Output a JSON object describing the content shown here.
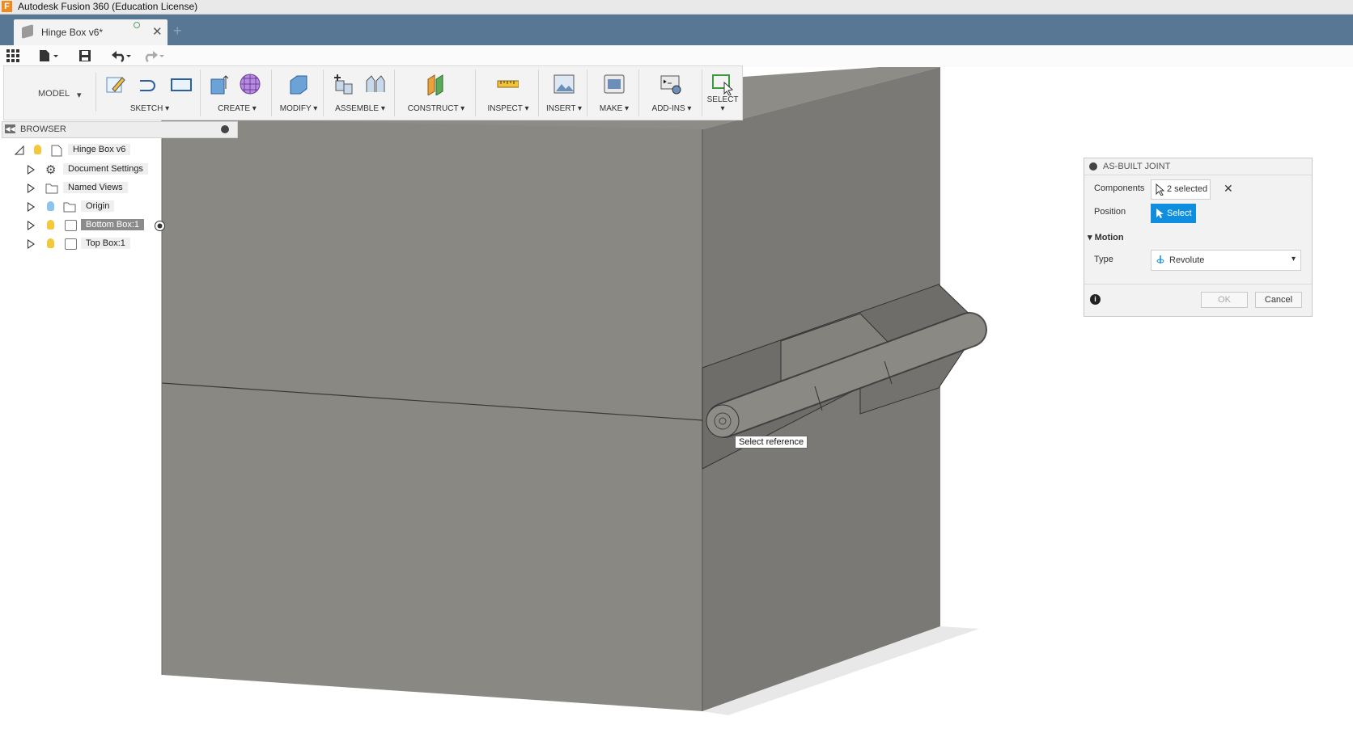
{
  "app": {
    "title": "Autodesk Fusion 360 (Education License)",
    "logo": "F"
  },
  "tabs": [
    {
      "label": "Hinge Box v6*"
    }
  ],
  "toolbar": {
    "workspace": "MODEL",
    "groups": [
      {
        "label": "SKETCH"
      },
      {
        "label": "CREATE"
      },
      {
        "label": "MODIFY"
      },
      {
        "label": "ASSEMBLE"
      },
      {
        "label": "CONSTRUCT"
      },
      {
        "label": "INSPECT"
      },
      {
        "label": "INSERT"
      },
      {
        "label": "MAKE"
      },
      {
        "label": "ADD-INS"
      },
      {
        "label": "SELECT"
      }
    ]
  },
  "browser": {
    "title": "BROWSER",
    "items": [
      {
        "label": "Hinge Box v6",
        "icon": "document-icon"
      },
      {
        "label": "Document Settings",
        "icon": "gear-icon"
      },
      {
        "label": "Named Views",
        "icon": "folder-icon"
      },
      {
        "label": "Origin",
        "icon": "folder-icon"
      },
      {
        "label": "Bottom Box:1",
        "icon": "component-icon"
      },
      {
        "label": "Top Box:1",
        "icon": "component-icon"
      }
    ]
  },
  "joint_panel": {
    "title": "AS-BUILT JOINT",
    "components_label": "Components",
    "components_value": "2 selected",
    "position_label": "Position",
    "position_button": "Select",
    "motion_label": "Motion",
    "type_label": "Type",
    "type_value": "Revolute",
    "ok": "OK",
    "cancel": "Cancel"
  },
  "tooltip": "Select reference",
  "colors": {
    "accent": "#0f8ee0",
    "tabbar": "#577794",
    "model_front": "#8a8883",
    "model_side": "#7a7874"
  }
}
